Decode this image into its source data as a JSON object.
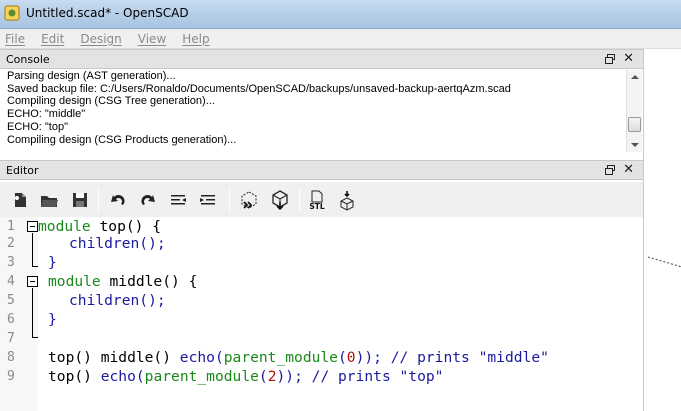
{
  "window": {
    "title": "Untitled.scad* - OpenSCAD"
  },
  "menu": {
    "items": [
      {
        "label": "File"
      },
      {
        "label": "Edit"
      },
      {
        "label": "Design"
      },
      {
        "label": "View"
      },
      {
        "label": "Help"
      }
    ]
  },
  "console": {
    "title": "Console",
    "float_icon": "float-icon",
    "close_glyph": "✕",
    "lines": [
      "Parsing design (AST generation)...",
      "Saved backup file: C:/Users/Ronaldo/Documents/OpenSCAD/backups/unsaved-backup-aertqAzm.scad",
      "Compiling design (CSG Tree generation)...",
      "ECHO: \"middle\"",
      "ECHO: \"top\"",
      "Compiling design (CSG Products generation)..."
    ]
  },
  "editor": {
    "title": "Editor",
    "close_glyph": "✕",
    "toolbar": [
      "new-file-icon",
      "open-file-icon",
      "save-icon",
      "undo-icon",
      "redo-icon",
      "unindent-icon",
      "indent-icon",
      "preview-icon",
      "render-icon",
      "export-stl-icon",
      "send-to-print-icon"
    ],
    "stl_label": "STL",
    "line_numbers": [
      "1",
      "2",
      "3",
      "4",
      "5",
      "6",
      "7",
      "8",
      "9"
    ],
    "code": {
      "l1_kw": "module",
      "l1_rest": " top() {",
      "l2_fn": "children",
      "l2_rest": "();",
      "l3": "}",
      "l4_kw": "module",
      "l4_rest": " middle() {",
      "l5_fn": "children",
      "l5_rest": "();",
      "l6": "}",
      "l8_a": "top() middle() ",
      "l8_echo": "echo",
      "l8_p1": "(",
      "l8_fn": "parent_module",
      "l8_p2": "(",
      "l8_num": "0",
      "l8_p3": ")); ",
      "l8_cmt": "// prints \"middle\"",
      "l9_a": "top() ",
      "l9_echo": "echo",
      "l9_p1": "(",
      "l9_fn": "parent_module",
      "l9_p2": "(",
      "l9_num": "2",
      "l9_p3": ")); ",
      "l9_cmt": "// prints \"top\""
    }
  }
}
